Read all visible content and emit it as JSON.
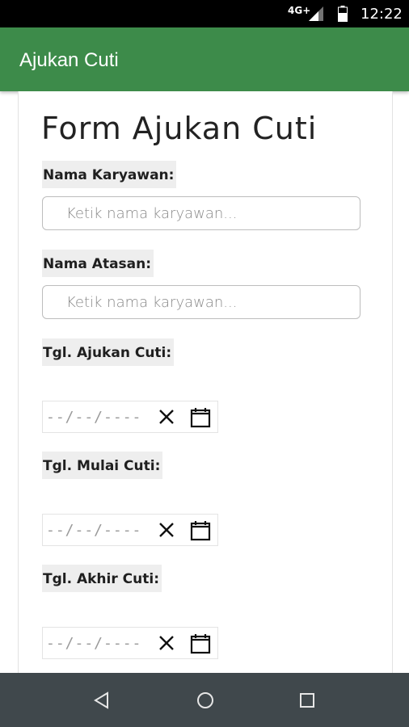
{
  "status_bar": {
    "network": "4G+",
    "time": "12:22",
    "icons": [
      "signal-icon",
      "battery-icon"
    ]
  },
  "app_bar": {
    "title": "Ajukan Cuti"
  },
  "form": {
    "title": "Form Ajukan Cuti",
    "nama_karyawan": {
      "label": "Nama Karyawan:",
      "placeholder": "Ketik nama karyawan...",
      "value": ""
    },
    "nama_atasan": {
      "label": "Nama Atasan:",
      "placeholder": "Ketik nama karyawan...",
      "value": ""
    },
    "tgl_ajukan": {
      "label": "Tgl. Ajukan Cuti:",
      "value": "--/--/----"
    },
    "tgl_mulai": {
      "label": "Tgl. Mulai Cuti:",
      "value": "--/--/----"
    },
    "tgl_akhir": {
      "label": "Tgl. Akhir Cuti:",
      "value": "--/--/----"
    }
  },
  "colors": {
    "app_bar": "#3d8b4a",
    "nav_bar": "#40484c",
    "status_bar": "#000000"
  },
  "nav_bar": {
    "icons": [
      "back-icon",
      "home-icon",
      "recents-icon"
    ]
  }
}
